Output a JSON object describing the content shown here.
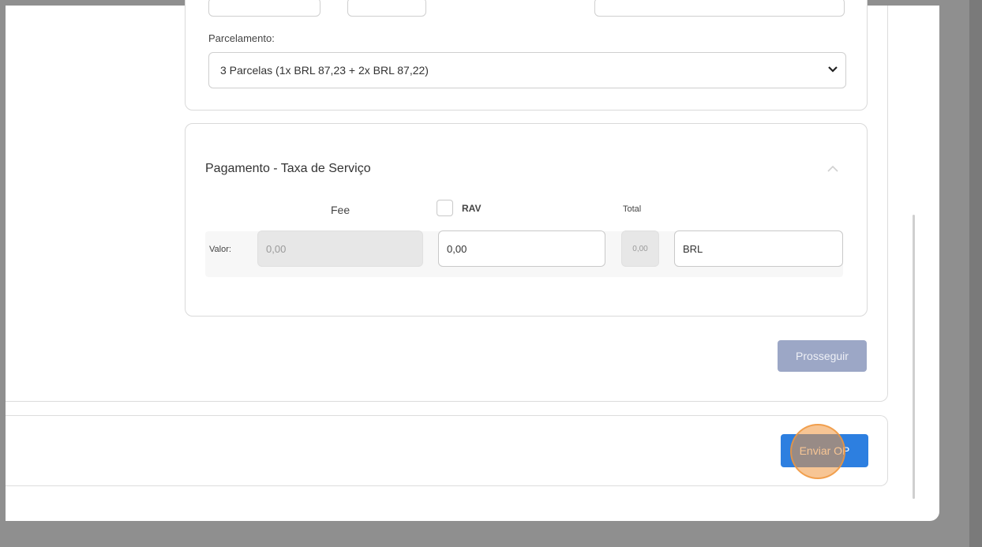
{
  "colors": {
    "backdrop": "#8f8f8f",
    "primary_button": "#2d7fe0",
    "disabled_button": "#9ca7c6",
    "click_indicator": "#f0963c"
  },
  "installments": {
    "label": "Parcelamento:",
    "selected": "3 Parcelas (1x BRL 87,23 + 2x BRL 87,22)",
    "caret_icon": "chevron-down-icon"
  },
  "service_fee": {
    "title": "Pagamento - Taxa de Serviço",
    "collapse_icon": "chevron-up-icon",
    "col_fee": "Fee",
    "col_rav": "RAV",
    "rav_checked": false,
    "col_total": "Total",
    "row_label": "Valor:",
    "fee_value": "0,00",
    "rav_value": "0,00",
    "total_value": "0,00",
    "currency": "BRL"
  },
  "actions": {
    "proceed": "Prosseguir",
    "send": "Enviar OP"
  }
}
